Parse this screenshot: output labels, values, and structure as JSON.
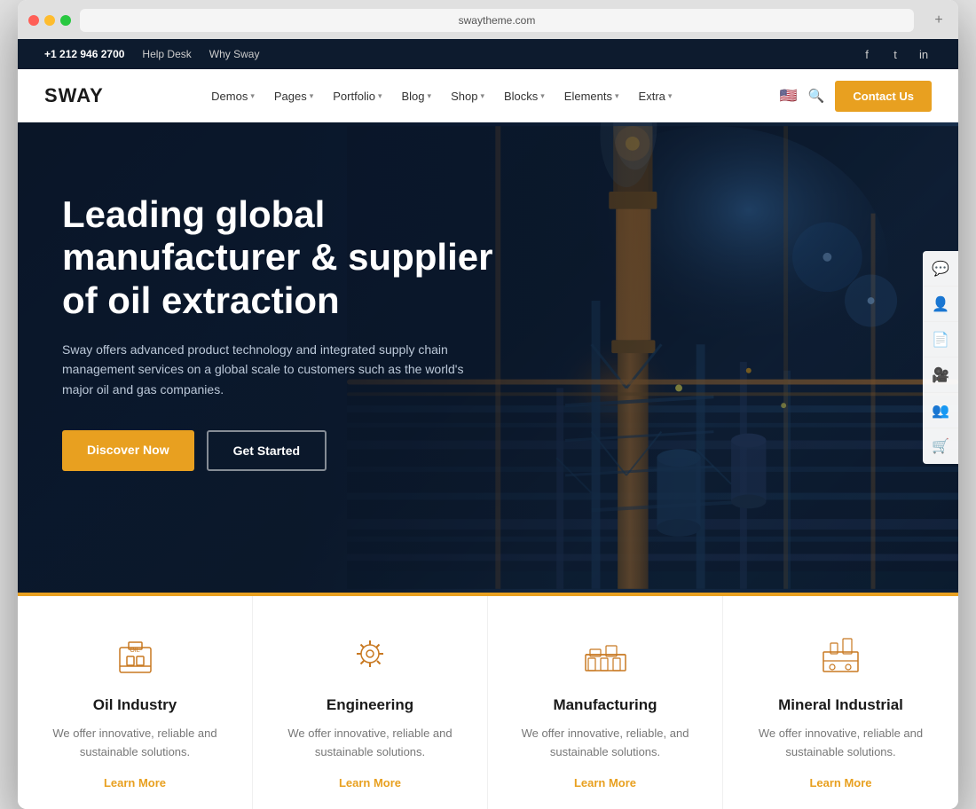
{
  "browser": {
    "url": "swaytheme.com",
    "new_tab_label": "+"
  },
  "top_bar": {
    "phone": "+1 212 946 2700",
    "help_desk": "Help Desk",
    "why_sway": "Why Sway",
    "social": {
      "facebook": "f",
      "twitter": "t",
      "linkedin": "in"
    }
  },
  "nav": {
    "logo": "SWAY",
    "links": [
      {
        "label": "Demos",
        "has_dropdown": true
      },
      {
        "label": "Pages",
        "has_dropdown": true
      },
      {
        "label": "Portfolio",
        "has_dropdown": true
      },
      {
        "label": "Blog",
        "has_dropdown": true
      },
      {
        "label": "Shop",
        "has_dropdown": true
      },
      {
        "label": "Blocks",
        "has_dropdown": true
      },
      {
        "label": "Elements",
        "has_dropdown": true
      },
      {
        "label": "Extra",
        "has_dropdown": true
      }
    ],
    "contact_label": "Contact Us"
  },
  "hero": {
    "title": "Leading global manufacturer & supplier of oil extraction",
    "description": "Sway offers advanced product technology and integrated supply chain management services on a global scale to customers such as the world's major oil and gas companies.",
    "btn_discover": "Discover Now",
    "btn_started": "Get Started"
  },
  "cards": [
    {
      "title": "Oil Industry",
      "description": "We offer innovative, reliable and sustainable solutions.",
      "link": "Learn More",
      "icon": "oil"
    },
    {
      "title": "Engineering",
      "description": "We offer innovative, reliable and sustainable solutions.",
      "link": "Learn More",
      "icon": "gear"
    },
    {
      "title": "Manufacturing",
      "description": "We offer innovative, reliable, and sustainable solutions.",
      "link": "Learn More",
      "icon": "factory"
    },
    {
      "title": "Mineral Industrial",
      "description": "We offer innovative, reliable and sustainable solutions.",
      "link": "Learn More",
      "icon": "mineral"
    }
  ],
  "side_widgets": [
    {
      "icon": "chat",
      "label": "chat-widget"
    },
    {
      "icon": "user",
      "label": "account-widget"
    },
    {
      "icon": "document",
      "label": "notes-widget"
    },
    {
      "icon": "video",
      "label": "video-widget"
    },
    {
      "icon": "group",
      "label": "team-widget"
    },
    {
      "icon": "cart",
      "label": "cart-widget"
    }
  ]
}
